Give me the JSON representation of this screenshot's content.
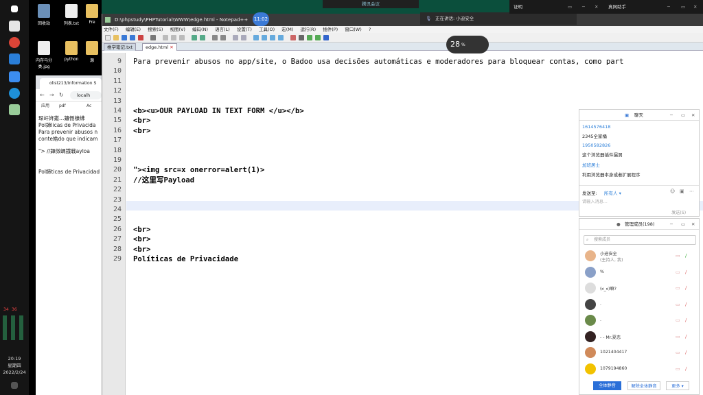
{
  "taskbar": {
    "time": "20:19",
    "weekday": "星期四",
    "date": "2022/2/24",
    "tray_numbers": [
      "34",
      "36"
    ]
  },
  "desktop_icons": [
    {
      "label": "回收站",
      "icon": "recycle-bin-icon"
    },
    {
      "label": "列表.txt",
      "icon": "text-file-icon"
    },
    {
      "label": "Fre",
      "icon": "folder-icon"
    },
    {
      "label": "内存马分类.jpg",
      "icon": "image-file-icon"
    },
    {
      "label": "python",
      "icon": "folder-icon"
    },
    {
      "label": "源",
      "icon": "folder-icon"
    }
  ],
  "browser": {
    "tab_title": "olist213/Information S",
    "address": "localh",
    "bookmarks": [
      "应用",
      "pdf",
      "Ac"
    ],
    "content_lines": [
      "琛屽姩鍖…鐮侀檺绋",
      "Pol鍗licas de Privacida",
      "Para prevenir abusos n",
      "conte皓do que indicam",
      "\"> //鍕傚嵎鐡戦ayloa",
      "Pol鍗ticas de Privacidad"
    ]
  },
  "notepad": {
    "title": "D:\\phpstudy\\PHPTutorial\\WWW\\edge.html - Notepad++",
    "menu": [
      "文件(F)",
      "编辑(E)",
      "搜索(S)",
      "视图(V)",
      "编码(N)",
      "语言(L)",
      "设置(T)",
      "工具(O)",
      "宏(M)",
      "运行(R)",
      "插件(P)",
      "窗口(W)",
      "?"
    ],
    "tabs": [
      "推学笔记.txt",
      "edge.html"
    ],
    "active_tab": 1,
    "lines": [
      {
        "num": "9",
        "text": "Para prevenir abusos no app/site, o Badoo usa decisões automáticas e moderadores para bloquear contas, como part"
      },
      {
        "num": "10",
        "text": ""
      },
      {
        "num": "11",
        "text": ""
      },
      {
        "num": "12",
        "text": ""
      },
      {
        "num": "13",
        "text": ""
      },
      {
        "num": "14",
        "text": "<b><u>OUR PAYLOAD IN TEXT FORM </u></b>"
      },
      {
        "num": "15",
        "text": "<br>"
      },
      {
        "num": "16",
        "text": "<br>"
      },
      {
        "num": "17",
        "text": ""
      },
      {
        "num": "18",
        "text": ""
      },
      {
        "num": "19",
        "text": ""
      },
      {
        "num": "20",
        "text": "\"><img src=x onerror=alert(1)>"
      },
      {
        "num": "21",
        "text": "//这里写Payload"
      },
      {
        "num": "22",
        "text": ""
      },
      {
        "num": "23",
        "text": ""
      },
      {
        "num": "24",
        "text": ""
      },
      {
        "num": "25",
        "text": ""
      },
      {
        "num": "26",
        "text": "<br>"
      },
      {
        "num": "27",
        "text": "<br>"
      },
      {
        "num": "28",
        "text": "<br>"
      },
      {
        "num": "29",
        "text": "Políticas de Privacidade"
      }
    ]
  },
  "overlay": {
    "meeting_label": "腾讯会议",
    "clock": "11:02",
    "speaking": "正在讲话: 小迪安全",
    "net_value": "28",
    "net_unit": "%"
  },
  "right_top": {
    "left_label": "证明",
    "right_label": "真网助手"
  },
  "chat": {
    "title": "聊天",
    "messages": [
      {
        "user": "1614576418",
        "text": "2345全家桶"
      },
      {
        "user": "1950582826",
        "text": "这个浏览器插件漏洞"
      },
      {
        "user": "加班居士",
        "text": "利用浏览器本身或者扩展程序"
      }
    ],
    "send_to_label": "发送至:",
    "send_to_value": "所有人",
    "input_placeholder": "请输入消息...",
    "send_button": "发送(S)"
  },
  "members": {
    "title": "管理成员(198)",
    "search_placeholder": "搜索成员",
    "list": [
      {
        "name": "小迪安全",
        "sub": "(主持人, 我)",
        "color": "#e8b48a"
      },
      {
        "name": "%",
        "sub": "",
        "color": "#8aa0c8"
      },
      {
        "name": "(ಠ_ಠ)嘛?",
        "sub": "",
        "color": "#dddddd"
      },
      {
        "name": ".",
        "sub": "",
        "color": "#444444"
      },
      {
        "name": ".",
        "sub": "",
        "color": "#6a8a4a"
      },
      {
        "name": "- - Mr.夏恋",
        "sub": "",
        "color": "#332222"
      },
      {
        "name": "1021404417",
        "sub": "",
        "color": "#d08a5a"
      },
      {
        "name": "1079194860",
        "sub": "",
        "color": "#f2c200"
      }
    ],
    "btn_mute_all": "全体静音",
    "btn_unmute_all": "解除全体静音",
    "btn_more": "更多"
  }
}
